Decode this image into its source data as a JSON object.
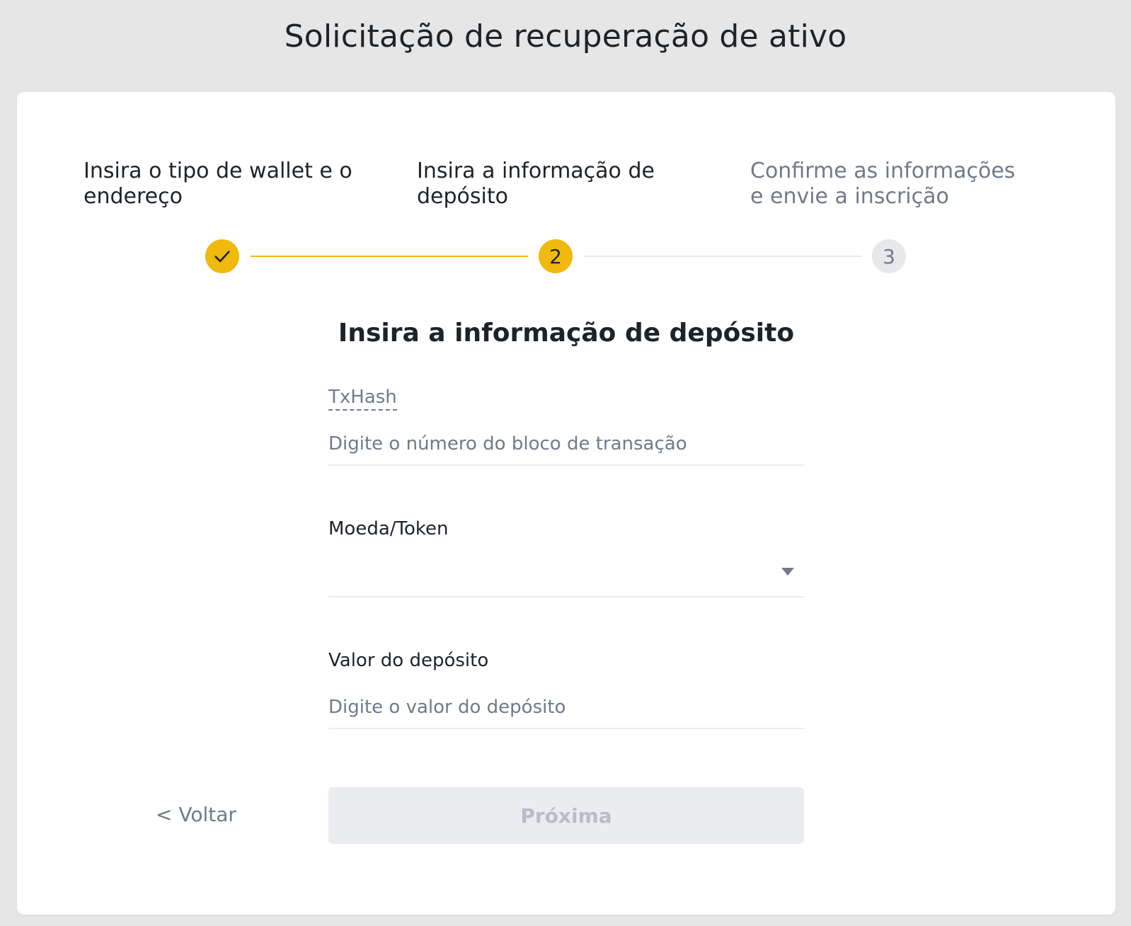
{
  "page": {
    "title": "Solicitação de recuperação de ativo"
  },
  "steps": [
    {
      "label": "Insira o tipo de wallet e o endereço",
      "status": "done",
      "marker": ""
    },
    {
      "label": "Insira a informação de depósito",
      "status": "active",
      "marker": "2"
    },
    {
      "label": "Confirme as informações e envie a inscrição",
      "status": "pending",
      "marker": "3"
    }
  ],
  "form": {
    "title": "Insira a informação de depósito",
    "txhash": {
      "label": "TxHash",
      "value": "",
      "placeholder": "Digite o número do bloco de transação"
    },
    "coin": {
      "label": "Moeda/Token",
      "selected": ""
    },
    "amount": {
      "label": "Valor do depósito",
      "value": "",
      "placeholder": "Digite o valor do depósito"
    }
  },
  "actions": {
    "back_label": "< Voltar",
    "next_label": "Próxima"
  },
  "colors": {
    "accent": "#f0b90b",
    "text": "#1e2329",
    "muted": "#707a8a",
    "disabled_bg": "#eaecef",
    "disabled_text": "#b7bdc6",
    "background": "#e6e6e6"
  }
}
